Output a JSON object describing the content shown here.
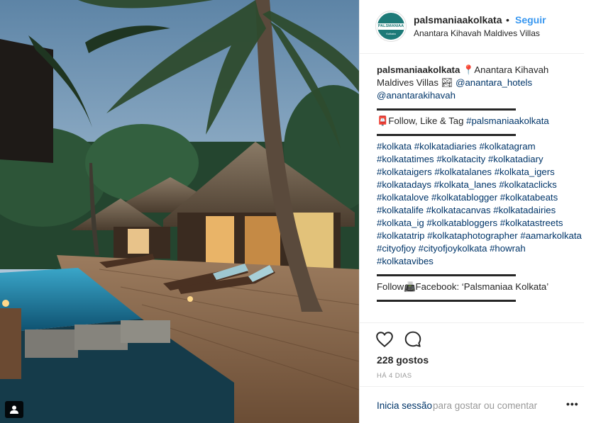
{
  "post": {
    "photo_icon": "person-tag-icon",
    "colors": {
      "link": "#003569",
      "follow": "#3897f0",
      "muted": "#999999"
    }
  },
  "header": {
    "avatar_label": "PALSMANIAA",
    "avatar_sublabel": "Kolkata",
    "username": "palsmaniaakolkata",
    "separator": "•",
    "follow_label": "Seguir",
    "location": "Anantara Kihavah Maldives Villas"
  },
  "caption": {
    "username": "palsmaniaakolkata",
    "pin_icon": "📍",
    "location_text": "Anantara Kihavah Maldives Villas",
    "photo_emoji": "🏞",
    "mention_1": "@anantara_hotels",
    "mention_2": "@anantarakihavah",
    "follow_emoji": "📮",
    "follow_text": "Follow, Like & Tag",
    "tag_main": "#palsmaniaakolkata",
    "hashtags": [
      "#kolkata",
      "#kolkatadiaries",
      "#kolkatagram",
      "#kolkatatimes",
      "#kolkatacity",
      "#kolkatadiary",
      "#kolkataigers",
      "#kolkatalanes",
      "#kolkata_igers",
      "#kolkatadays",
      "#kolkata_lanes",
      "#kolkataclicks",
      "#kolkatalove",
      "#kolkatablogger",
      "#kolkatabeats",
      "#kolkatalife",
      "#kolkatacanvas",
      "#kolkatadairies",
      "#kolkata_ig",
      "#kolkatabloggers",
      "#kolkatastreets",
      "#kolkatatrip",
      "#kolkataphotographer",
      "#aamarkolkata",
      "#cityofjoy",
      "#cityofjoykolkata",
      "#howrah",
      "#kolkatavibes"
    ],
    "fb_prefix": "Follow",
    "fb_emoji": "📠",
    "fb_text": "Facebook: ‘Palsmaniaa Kolkata’"
  },
  "actions": {
    "like_icon": "heart-icon",
    "comment_icon": "comment-bubble-icon",
    "likes": "228 gostos",
    "time_ago": "HÁ 4 DIAS"
  },
  "comment_bar": {
    "login_link": "Inicia sessão",
    "login_rest": "para gostar ou comentar",
    "more_label": "•••"
  }
}
